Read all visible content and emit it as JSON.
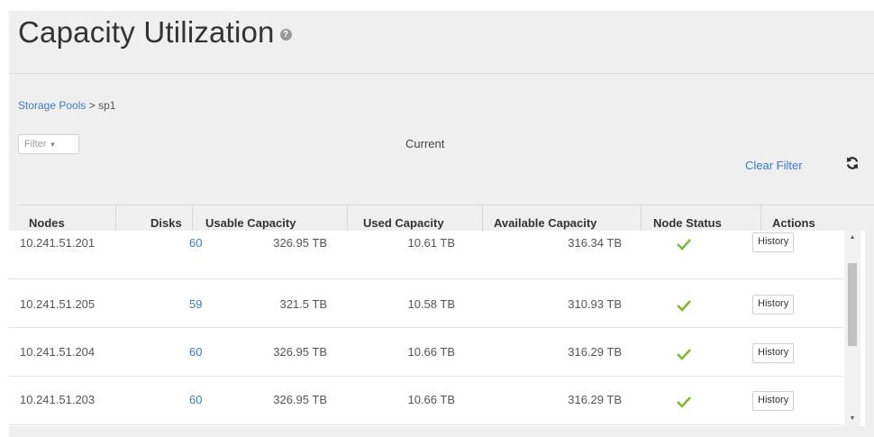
{
  "page": {
    "title": "Capacity Utilization",
    "help_icon": "help-icon"
  },
  "breadcrumb": {
    "link": "Storage Pools",
    "separator": ">",
    "current": "sp1"
  },
  "filter": {
    "label": "Filter",
    "caret": "▼"
  },
  "current_label": "Current",
  "clear_filter": "Clear Filter",
  "table": {
    "columns": [
      "Nodes",
      "Disks",
      "Usable Capacity",
      "Used Capacity",
      "Available Capacity",
      "Node Status",
      "Actions"
    ],
    "rows": [
      {
        "node": "10.241.51.201",
        "disks": "60",
        "usable": "326.95 TB",
        "used": "10.61 TB",
        "available": "316.34 TB",
        "status": "ok",
        "action": "History"
      },
      {
        "node": "10.241.51.205",
        "disks": "59",
        "usable": "321.5 TB",
        "used": "10.58 TB",
        "available": "310.93 TB",
        "status": "ok",
        "action": "History"
      },
      {
        "node": "10.241.51.204",
        "disks": "60",
        "usable": "326.95 TB",
        "used": "10.66 TB",
        "available": "316.29 TB",
        "status": "ok",
        "action": "History"
      },
      {
        "node": "10.241.51.203",
        "disks": "60",
        "usable": "326.95 TB",
        "used": "10.66 TB",
        "available": "316.29 TB",
        "status": "ok",
        "action": "History"
      }
    ]
  },
  "colors": {
    "link": "#3c7bbf",
    "check": "#7cb83a",
    "panel": "#efefef"
  }
}
